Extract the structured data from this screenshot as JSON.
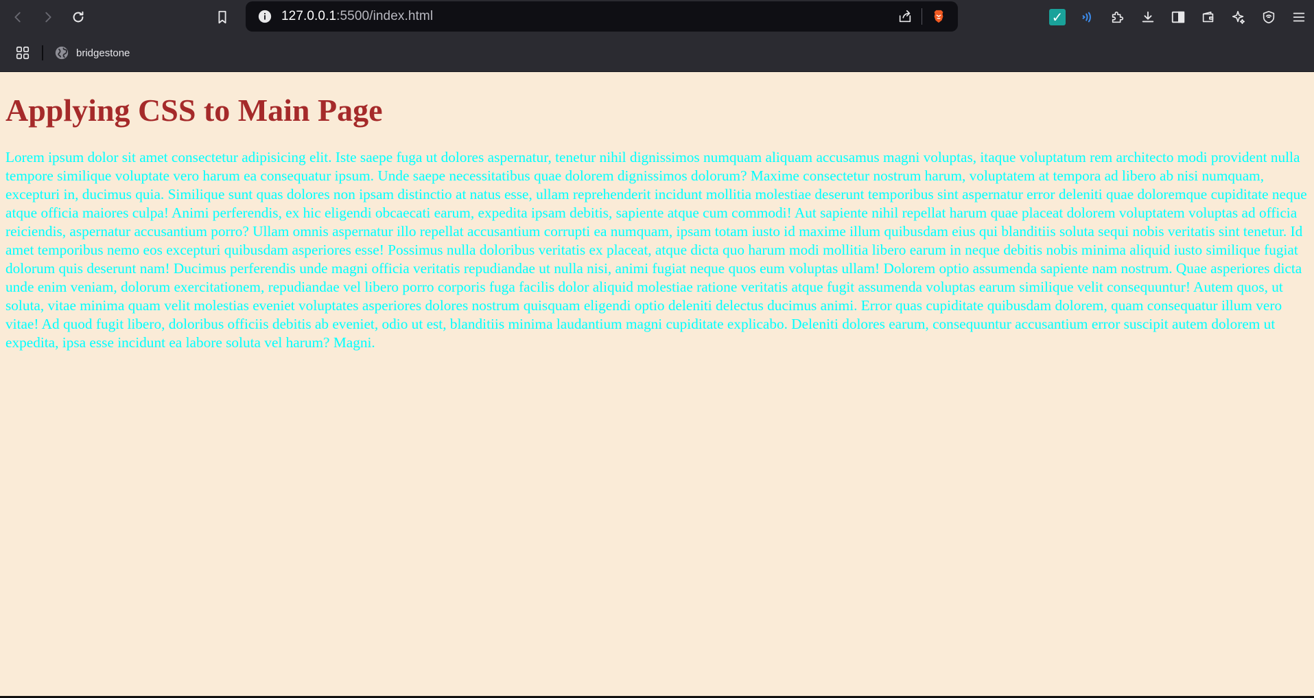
{
  "browser": {
    "url_host": "127.0.0.1",
    "url_rest": ":5500/index.html",
    "bookmark": {
      "label": "bridgestone"
    },
    "icons": {
      "back": "arrow-left-icon",
      "forward": "arrow-right-icon",
      "reload": "reload-icon",
      "bookmark": "bookmark-icon",
      "info": "info-icon",
      "share": "share-icon",
      "brave_shield": "brave-lion-icon",
      "extension_check": "checkmark-extension-icon",
      "speech": "speech-extension-icon",
      "extensions": "puzzle-icon",
      "downloads": "download-icon",
      "sidebar": "sidebar-icon",
      "wallet": "wallet-icon",
      "leo": "ai-sparkle-icon",
      "vpn": "vpn-shield-icon",
      "menu": "hamburger-menu-icon",
      "apps": "apps-grid-icon",
      "globe": "globe-icon"
    }
  },
  "page": {
    "heading": "Applying CSS to Main Page",
    "paragraph": "Lorem ipsum dolor sit amet consectetur adipisicing elit. Iste saepe fuga ut dolores aspernatur, tenetur nihil dignissimos numquam aliquam accusamus magni voluptas, itaque voluptatum rem architecto modi provident nulla tempore similique voluptate vero harum ea consequatur ipsum. Unde saepe necessitatibus quae dolorem dignissimos dolorum? Maxime consectetur nostrum harum, voluptatem at tempora ad libero ab nisi numquam, excepturi in, ducimus quia. Similique sunt quas dolores non ipsam distinctio at natus esse, ullam reprehenderit incidunt mollitia molestiae deserunt temporibus sint aspernatur error deleniti quae doloremque cupiditate neque atque officia maiores culpa! Animi perferendis, ex hic eligendi obcaecati earum, expedita ipsam debitis, sapiente atque cum commodi! Aut sapiente nihil repellat harum quae placeat dolorem voluptatem voluptas ad officia reiciendis, aspernatur accusantium porro? Ullam omnis aspernatur illo repellat accusantium corrupti ea numquam, ipsam totam iusto id maxime illum quibusdam eius qui blanditiis soluta sequi nobis veritatis sint tenetur. Id amet temporibus nemo eos excepturi quibusdam asperiores esse! Possimus nulla doloribus veritatis ex placeat, atque dicta quo harum modi mollitia libero earum in neque debitis nobis minima aliquid iusto similique fugiat dolorum quis deserunt nam! Ducimus perferendis unde magni officia veritatis repudiandae ut nulla nisi, animi fugiat neque quos eum voluptas ullam! Dolorem optio assumenda sapiente nam nostrum. Quae asperiores dicta unde enim veniam, dolorum exercitationem, repudiandae vel libero porro corporis fuga facilis dolor aliquid molestiae ratione veritatis atque fugit assumenda voluptas earum similique velit consequuntur! Autem quos, ut soluta, vitae minima quam velit molestias eveniet voluptates asperiores dolores nostrum quisquam eligendi optio deleniti delectus ducimus animi. Error quas cupiditate quibusdam dolorem, quam consequatur illum vero vitae! Ad quod fugit libero, doloribus officiis debitis ab eveniet, odio ut est, blanditiis minima laudantium magni cupiditate explicabo. Deleniti dolores earum, consequuntur accusantium error suscipit autem dolorem ut expedita, ipsa esse incidunt ea labore soluta vel harum? Magni."
  },
  "colors": {
    "page_background": "#faebd7",
    "heading": "#a52a2a",
    "paragraph": "#00ffff",
    "toolbar": "#2b2b31",
    "omnibox": "#0f0f14"
  }
}
